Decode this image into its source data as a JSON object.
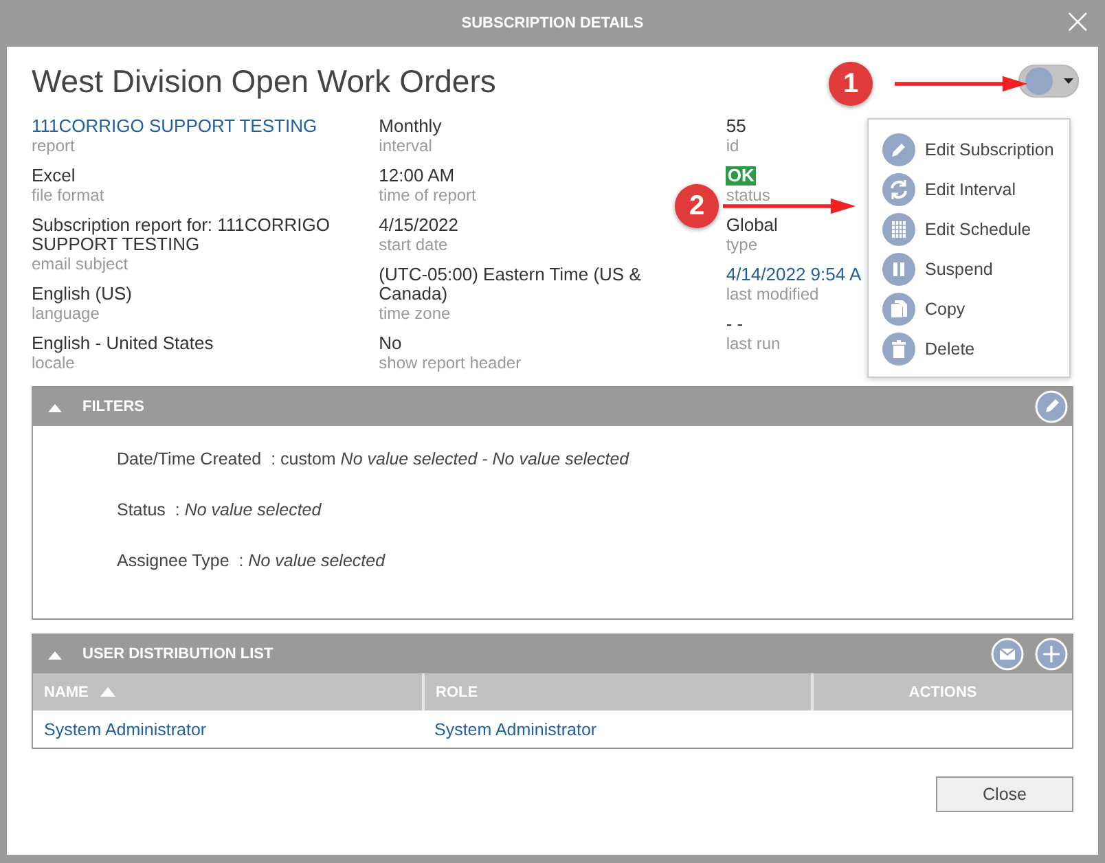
{
  "dialog": {
    "title": "SUBSCRIPTION DETAILS",
    "close_icon": "×"
  },
  "heading": "West Division Open Work Orders",
  "details": [
    [
      {
        "value": "111CORRIGO SUPPORT TESTING",
        "label": "report",
        "kind": "link"
      },
      {
        "value": "Excel",
        "label": "file format",
        "kind": "text"
      },
      {
        "value": "Subscription report for: 111CORRIGO SUPPORT TESTING",
        "label": "email subject",
        "kind": "text"
      },
      {
        "value": "English (US)",
        "label": "language",
        "kind": "text"
      },
      {
        "value": "English - United States",
        "label": "locale",
        "kind": "text"
      }
    ],
    [
      {
        "value": "Monthly",
        "label": "interval",
        "kind": "text"
      },
      {
        "value": "12:00 AM",
        "label": "time of report",
        "kind": "text"
      },
      {
        "value": "4/15/2022",
        "label": "start date",
        "kind": "text"
      },
      {
        "value": "(UTC-05:00) Eastern Time (US & Canada)",
        "label": "time zone",
        "kind": "text"
      },
      {
        "value": "No",
        "label": "show report header",
        "kind": "text"
      }
    ],
    [
      {
        "value": "55",
        "label": "id",
        "kind": "text"
      },
      {
        "value": "OK",
        "label": "status",
        "kind": "badge"
      },
      {
        "value": "Global",
        "label": "type",
        "kind": "text"
      },
      {
        "value": "4/14/2022 9:54 A",
        "label": "last modified",
        "kind": "link"
      },
      {
        "value": "- -",
        "label": "last run",
        "kind": "text"
      }
    ]
  ],
  "menu": {
    "expanded": true,
    "items": [
      {
        "label": "Edit Subscription",
        "kind": "edit"
      },
      {
        "label": "Edit Interval",
        "kind": "refresh"
      },
      {
        "label": "Edit Schedule",
        "kind": "calendar"
      },
      {
        "label": "Suspend",
        "kind": "pause"
      },
      {
        "label": "Copy",
        "kind": "copy"
      },
      {
        "label": "Delete",
        "kind": "delete"
      }
    ]
  },
  "annotations": [
    {
      "number": "1"
    },
    {
      "number": "2"
    }
  ],
  "filters": {
    "title": "FILTERS",
    "expanded": true,
    "rows": [
      {
        "label": "Date/Time Created  :",
        "prefix": "custom",
        "value": "No value selected - No value selected"
      },
      {
        "label": "Status  :",
        "value": "No value selected"
      },
      {
        "label": "Assignee Type  :",
        "value": "No value selected"
      }
    ]
  },
  "distribution": {
    "title": "USER DISTRIBUTION LIST",
    "expanded": true,
    "columns": [
      {
        "label": "NAME",
        "sorted": true
      },
      {
        "label": "ROLE",
        "sorted": false
      },
      {
        "label": "ACTIONS",
        "sorted": false
      }
    ],
    "rows": [
      [
        "System Administrator",
        "System Administrator",
        null
      ]
    ]
  },
  "buttons": [
    "Close"
  ]
}
